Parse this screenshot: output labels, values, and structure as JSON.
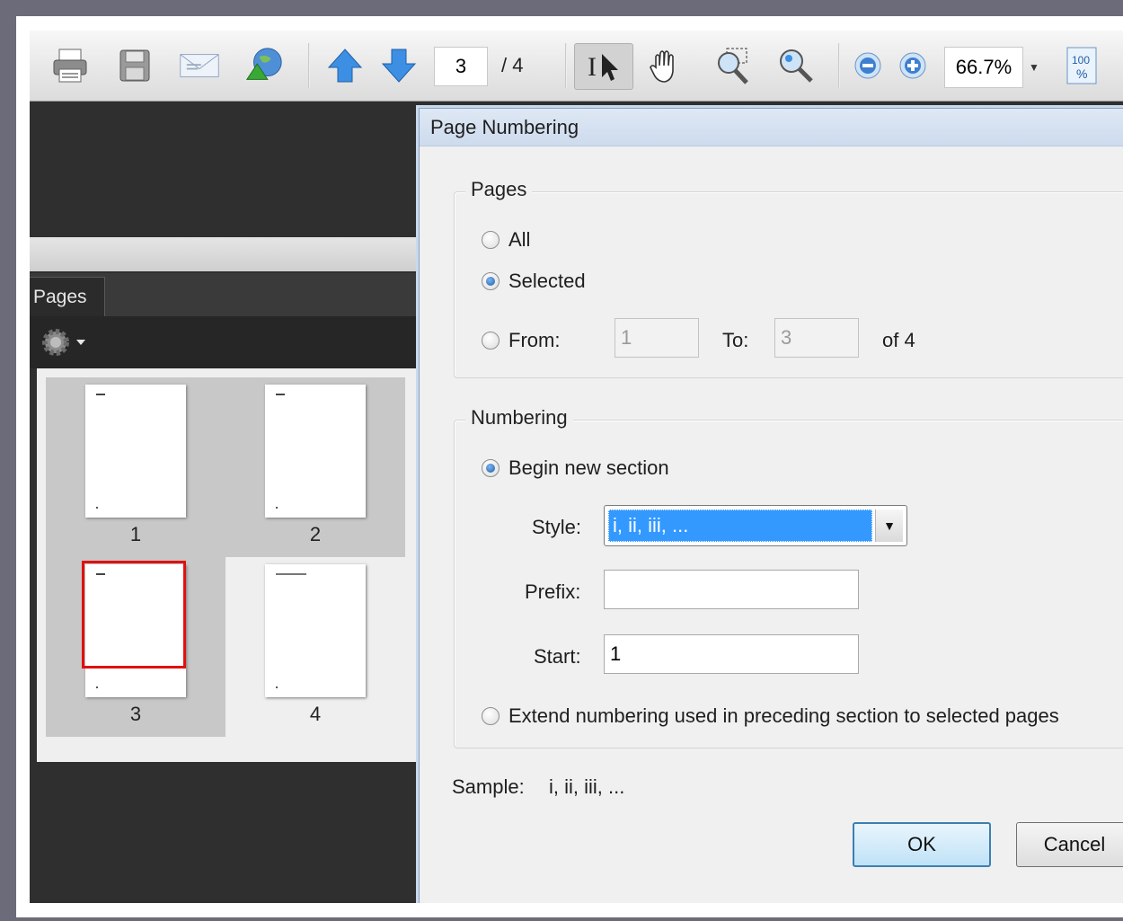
{
  "toolbar": {
    "current_page": "3",
    "total_pages": "/ 4",
    "zoom": "66.7%",
    "icons": [
      "print-icon",
      "save-icon",
      "email-icon",
      "share-icon",
      "previous-page-icon",
      "next-page-icon",
      "select-tool-icon",
      "hand-tool-icon",
      "marquee-zoom-icon",
      "zoom-tool-icon",
      "zoom-out-icon",
      "zoom-in-icon",
      "actual-size-icon"
    ]
  },
  "pages_panel": {
    "tab_label": "Pages",
    "thumbnails": [
      {
        "label": "1",
        "selected": true
      },
      {
        "label": "2",
        "selected": true
      },
      {
        "label": "3",
        "selected": true
      },
      {
        "label": "4",
        "selected": false
      }
    ]
  },
  "dialog": {
    "title": "Page Numbering",
    "pages_group": {
      "legend": "Pages",
      "all_label": "All",
      "selected_label": "Selected",
      "from_label": "From:",
      "from_value": "1",
      "to_label": "To:",
      "to_value": "3",
      "of_label": "of 4",
      "selected_option": "Selected"
    },
    "numbering_group": {
      "legend": "Numbering",
      "begin_label": "Begin new section",
      "style_label": "Style:",
      "style_value": "i, ii, iii, ...",
      "prefix_label": "Prefix:",
      "prefix_value": "",
      "start_label": "Start:",
      "start_value": "1",
      "extend_label": "Extend numbering used in preceding section to selected pages",
      "selected_option": "Begin new section"
    },
    "sample_label": "Sample:",
    "sample_value": "i, ii, iii, ...",
    "ok_label": "OK",
    "cancel_label": "Cancel"
  },
  "colors": {
    "selection_blue": "#3399ff",
    "thumbnail_highlight": "#e01010",
    "default_button_border": "#3c7fb1"
  }
}
